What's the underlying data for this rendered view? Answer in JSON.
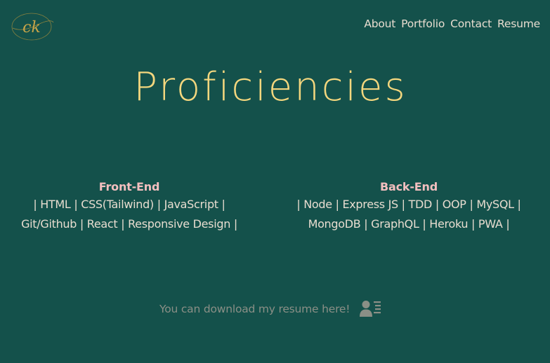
{
  "logo": {
    "text": "ck",
    "icon": "ck-monogram-logo",
    "color": "#b8953a"
  },
  "nav": {
    "items": [
      "About",
      "Portfolio",
      "Contact",
      "Resume"
    ]
  },
  "main": {
    "title": "Proficiencies",
    "front_end": {
      "heading": "Front-End",
      "line1": "| HTML | CSS(Tailwind) | JavaScript |",
      "line2": "Git/Github | React | Responsive Design |"
    },
    "back_end": {
      "heading": "Back-End",
      "line1": "| Node | Express JS | TDD | OOP | MySQL |",
      "line2": "MongoDB | GraphQL | Heroku | PWA |"
    }
  },
  "download": {
    "text": "You can download my resume here!",
    "icon": "resume-icon"
  },
  "colors": {
    "background": "#14514b",
    "title": "#f4d77e",
    "heading": "#f3bfbf",
    "text": "#e8ddd0",
    "muted": "#8a8f86"
  }
}
